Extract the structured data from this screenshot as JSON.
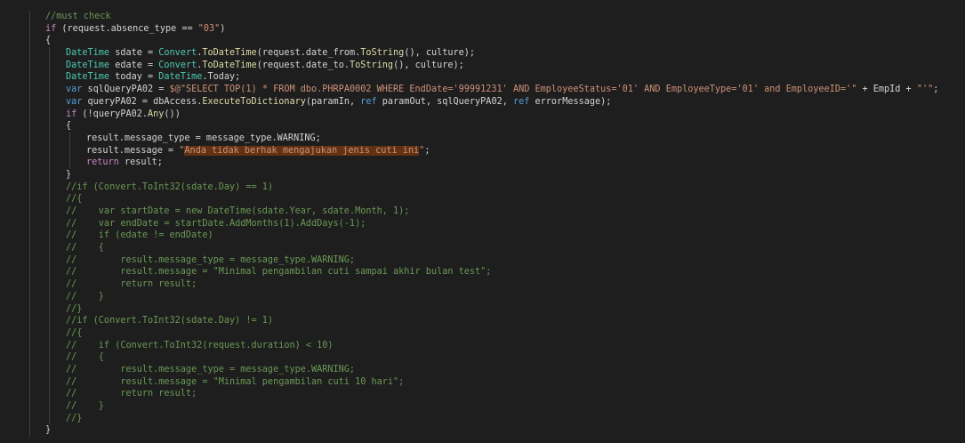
{
  "editor": {
    "language": "csharp",
    "theme": {
      "background": "#1e1e1e",
      "keyword": "#569cd6",
      "control": "#c586c0",
      "type": "#4ec9b0",
      "function": "#dcdcaa",
      "variable": "#9cdcfe",
      "string": "#ce9178",
      "comment": "#6a9955",
      "plain": "#d4d4d4",
      "find_highlight": "#613214"
    },
    "lines": [
      {
        "indent": 0,
        "tokens": [
          {
            "t": "//must check",
            "c": "cm"
          }
        ]
      },
      {
        "indent": 0,
        "tokens": [
          {
            "t": "if",
            "c": "ctl"
          },
          {
            "t": " (request.absence_type == ",
            "c": "op"
          },
          {
            "t": "\"03\"",
            "c": "str"
          },
          {
            "t": ")",
            "c": "op"
          }
        ]
      },
      {
        "indent": 0,
        "tokens": [
          {
            "t": "{",
            "c": "op"
          }
        ]
      },
      {
        "indent": 1,
        "tokens": [
          {
            "t": "DateTime",
            "c": "type"
          },
          {
            "t": " sdate = ",
            "c": "op"
          },
          {
            "t": "Convert",
            "c": "type"
          },
          {
            "t": ".",
            "c": "op"
          },
          {
            "t": "ToDateTime",
            "c": "fn"
          },
          {
            "t": "(request.date_from.",
            "c": "op"
          },
          {
            "t": "ToString",
            "c": "fn"
          },
          {
            "t": "(), culture);",
            "c": "op"
          }
        ]
      },
      {
        "indent": 1,
        "tokens": [
          {
            "t": "DateTime",
            "c": "type"
          },
          {
            "t": " edate = ",
            "c": "op"
          },
          {
            "t": "Convert",
            "c": "type"
          },
          {
            "t": ".",
            "c": "op"
          },
          {
            "t": "ToDateTime",
            "c": "fn"
          },
          {
            "t": "(request.date_to.",
            "c": "op"
          },
          {
            "t": "ToString",
            "c": "fn"
          },
          {
            "t": "(), culture);",
            "c": "op"
          }
        ]
      },
      {
        "indent": 1,
        "tokens": [
          {
            "t": "DateTime",
            "c": "type"
          },
          {
            "t": " today = ",
            "c": "op"
          },
          {
            "t": "DateTime",
            "c": "type"
          },
          {
            "t": ".Today;",
            "c": "op"
          }
        ]
      },
      {
        "indent": 1,
        "tokens": [
          {
            "t": "var",
            "c": "kw"
          },
          {
            "t": " sqlQueryPA02 = ",
            "c": "op"
          },
          {
            "t": "$@\"SELECT TOP(1) * FROM dbo.PHRPA0002 WHERE EndDate='99991231' AND EmployeeStatus='01' AND EmployeeType='01' and EmployeeID='\"",
            "c": "str"
          },
          {
            "t": " + EmpId + ",
            "c": "op"
          },
          {
            "t": "\"'\"",
            "c": "str"
          },
          {
            "t": ";",
            "c": "op"
          }
        ]
      },
      {
        "indent": 1,
        "tokens": [
          {
            "t": "var",
            "c": "kw"
          },
          {
            "t": " queryPA02 = dbAccess.",
            "c": "op"
          },
          {
            "t": "ExecuteToDictionary",
            "c": "fn"
          },
          {
            "t": "(paramIn, ",
            "c": "op"
          },
          {
            "t": "ref",
            "c": "kw"
          },
          {
            "t": " paramOut, sqlQueryPA02, ",
            "c": "op"
          },
          {
            "t": "ref",
            "c": "kw"
          },
          {
            "t": " errorMessage);",
            "c": "op"
          }
        ]
      },
      {
        "indent": 1,
        "tokens": [
          {
            "t": "if",
            "c": "ctl"
          },
          {
            "t": " (!queryPA02.",
            "c": "op"
          },
          {
            "t": "Any",
            "c": "fn"
          },
          {
            "t": "())",
            "c": "op"
          }
        ]
      },
      {
        "indent": 1,
        "tokens": [
          {
            "t": "{",
            "c": "op"
          }
        ]
      },
      {
        "indent": 2,
        "tokens": [
          {
            "t": "result.message_type = message_type.WARNING;",
            "c": "op"
          }
        ]
      },
      {
        "indent": 2,
        "tokens": [
          {
            "t": "result.message = ",
            "c": "op"
          },
          {
            "t": "\"",
            "c": "str"
          },
          {
            "t": "Anda tidak berhak mengajukan jenis cuti ini",
            "c": "str",
            "sel": true
          },
          {
            "t": "\"",
            "c": "str"
          },
          {
            "t": ";",
            "c": "op"
          }
        ]
      },
      {
        "indent": 2,
        "tokens": [
          {
            "t": "return",
            "c": "ctl"
          },
          {
            "t": " result;",
            "c": "op"
          }
        ]
      },
      {
        "indent": 1,
        "tokens": [
          {
            "t": "}",
            "c": "op"
          }
        ]
      },
      {
        "indent": 1,
        "tokens": [
          {
            "t": "//if (Convert.ToInt32(sdate.Day) == 1)",
            "c": "cm"
          }
        ]
      },
      {
        "indent": 1,
        "tokens": [
          {
            "t": "//{",
            "c": "cm"
          }
        ]
      },
      {
        "indent": 1,
        "tokens": [
          {
            "t": "//    var startDate = new DateTime(sdate.Year, sdate.Month, 1);",
            "c": "cm"
          }
        ]
      },
      {
        "indent": 1,
        "tokens": [
          {
            "t": "//    var endDate = startDate.AddMonths(1).AddDays(-1);",
            "c": "cm"
          }
        ]
      },
      {
        "indent": 1,
        "tokens": [
          {
            "t": "//    if (edate != endDate)",
            "c": "cm"
          }
        ]
      },
      {
        "indent": 1,
        "tokens": [
          {
            "t": "//    {",
            "c": "cm"
          }
        ]
      },
      {
        "indent": 1,
        "tokens": [
          {
            "t": "//        result.message_type = message_type.WARNING;",
            "c": "cm"
          }
        ]
      },
      {
        "indent": 1,
        "tokens": [
          {
            "t": "//        result.message = \"Minimal pengambilan cuti sampai akhir bulan test\";",
            "c": "cm"
          }
        ]
      },
      {
        "indent": 1,
        "tokens": [
          {
            "t": "//        return result;",
            "c": "cm"
          }
        ]
      },
      {
        "indent": 1,
        "tokens": [
          {
            "t": "//    }",
            "c": "cm"
          }
        ]
      },
      {
        "indent": 1,
        "tokens": [
          {
            "t": "//}",
            "c": "cm"
          }
        ]
      },
      {
        "indent": 1,
        "tokens": [
          {
            "t": "//if (Convert.ToInt32(sdate.Day) != 1)",
            "c": "cm"
          }
        ]
      },
      {
        "indent": 1,
        "tokens": [
          {
            "t": "//{",
            "c": "cm"
          }
        ]
      },
      {
        "indent": 1,
        "tokens": [
          {
            "t": "//    if (Convert.ToInt32(request.duration) < 10)",
            "c": "cm"
          }
        ]
      },
      {
        "indent": 1,
        "tokens": [
          {
            "t": "//    {",
            "c": "cm"
          }
        ]
      },
      {
        "indent": 1,
        "tokens": [
          {
            "t": "//        result.message_type = message_type.WARNING;",
            "c": "cm"
          }
        ]
      },
      {
        "indent": 1,
        "tokens": [
          {
            "t": "//        result.message = \"Minimal pengambilan cuti 10 hari\";",
            "c": "cm"
          }
        ]
      },
      {
        "indent": 1,
        "tokens": [
          {
            "t": "//        return result;",
            "c": "cm"
          }
        ]
      },
      {
        "indent": 1,
        "tokens": [
          {
            "t": "//    }",
            "c": "cm"
          }
        ]
      },
      {
        "indent": 1,
        "tokens": [
          {
            "t": "//}",
            "c": "cm"
          }
        ]
      },
      {
        "indent": 0,
        "tokens": [
          {
            "t": "}",
            "c": "op"
          }
        ]
      }
    ]
  }
}
